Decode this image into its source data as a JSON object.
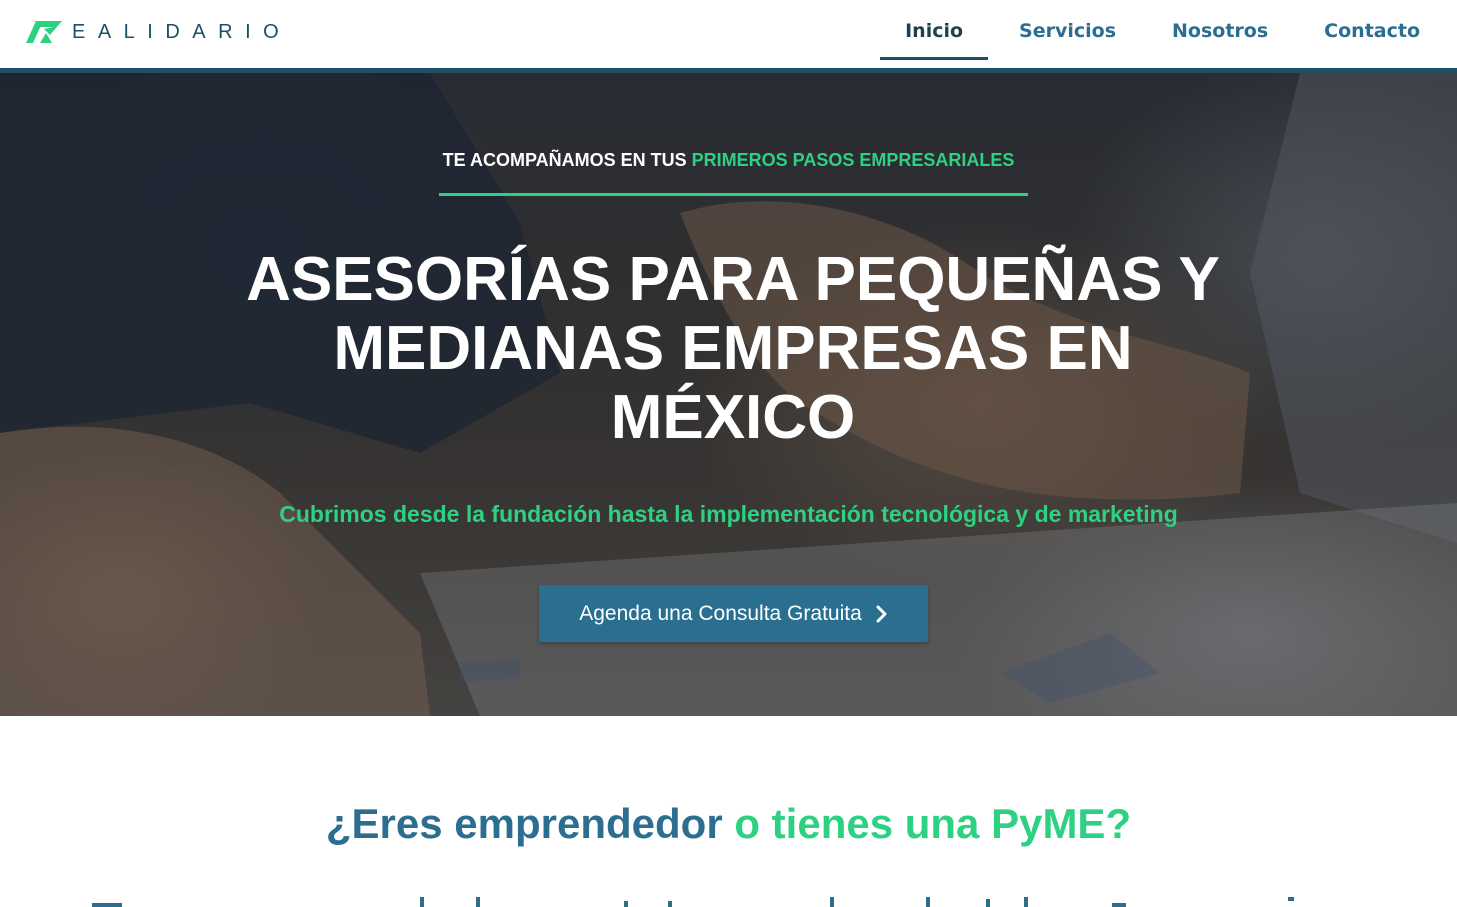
{
  "header": {
    "logo_text": "EALIDARIO",
    "nav": [
      {
        "label": "Inicio",
        "active": true
      },
      {
        "label": "Servicios",
        "active": false
      },
      {
        "label": "Nosotros",
        "active": false
      },
      {
        "label": "Contacto",
        "active": false
      }
    ]
  },
  "hero": {
    "eyebrow_prefix": "TE ACOMPAÑAMOS EN TUS ",
    "eyebrow_accent": "PRIMEROS PASOS EMPRESARIALES",
    "title_line1": "ASESORÍAS PARA PEQUEÑAS Y",
    "title_line2": "MEDIANAS EMPRESAS EN",
    "title_line3": "MÉXICO",
    "subtitle": "Cubrimos desde la fundación hasta la implementación tecnológica y de marketing",
    "cta_label": "Agenda una Consulta Gratuita",
    "cta_icon": "chevron-right-icon"
  },
  "section": {
    "title_prefix": "¿Eres emprendedor ",
    "title_accent": "o tienes una PyME?"
  },
  "colors": {
    "brand_dark": "#1f4f67",
    "brand_blue": "#2b6e8f",
    "accent_green": "#2ed182",
    "cta_bg": "#2a6f8f"
  }
}
